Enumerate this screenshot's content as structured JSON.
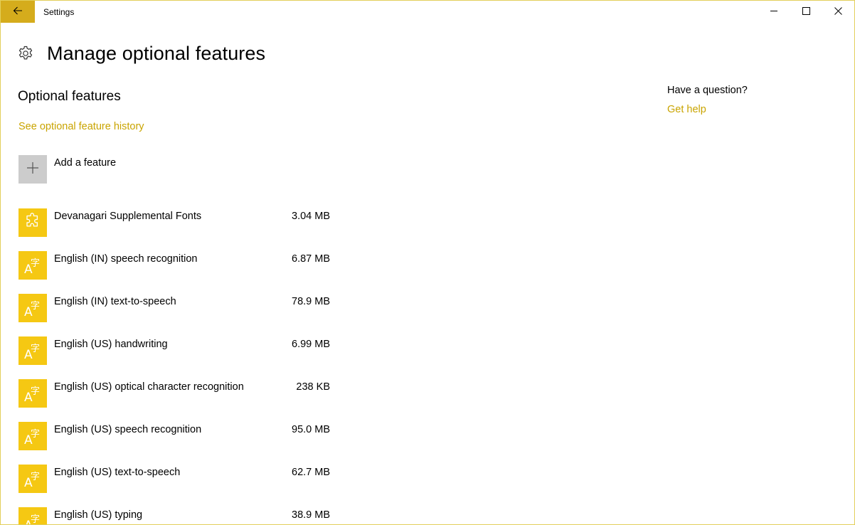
{
  "window": {
    "title": "Settings",
    "accent_color": "#d5ac1c",
    "link_color": "#c9a400",
    "tile_color": "#f5c813",
    "controls": [
      "minimize-icon",
      "maximize-icon",
      "close-icon"
    ]
  },
  "header": {
    "icon": "gear-icon",
    "title": "Manage optional features"
  },
  "main": {
    "section_title": "Optional features",
    "history_link": "See optional feature history",
    "add_feature": {
      "icon": "plus-icon",
      "label": "Add a feature"
    },
    "features": [
      {
        "name": "Devanagari Supplemental Fonts",
        "size": "3.04 MB",
        "icon": "puzzle-icon"
      },
      {
        "name": "English (IN) speech recognition",
        "size": "6.87 MB",
        "icon": "language-icon"
      },
      {
        "name": "English (IN) text-to-speech",
        "size": "78.9 MB",
        "icon": "language-icon"
      },
      {
        "name": "English (US) handwriting",
        "size": "6.99 MB",
        "icon": "language-icon"
      },
      {
        "name": "English (US) optical character recognition",
        "size": "238 KB",
        "icon": "language-icon"
      },
      {
        "name": "English (US) speech recognition",
        "size": "95.0 MB",
        "icon": "language-icon"
      },
      {
        "name": "English (US) text-to-speech",
        "size": "62.7 MB",
        "icon": "language-icon"
      },
      {
        "name": "English (US) typing",
        "size": "38.9 MB",
        "icon": "language-icon"
      }
    ]
  },
  "sidebar": {
    "question": "Have a question?",
    "help_link": "Get help"
  }
}
